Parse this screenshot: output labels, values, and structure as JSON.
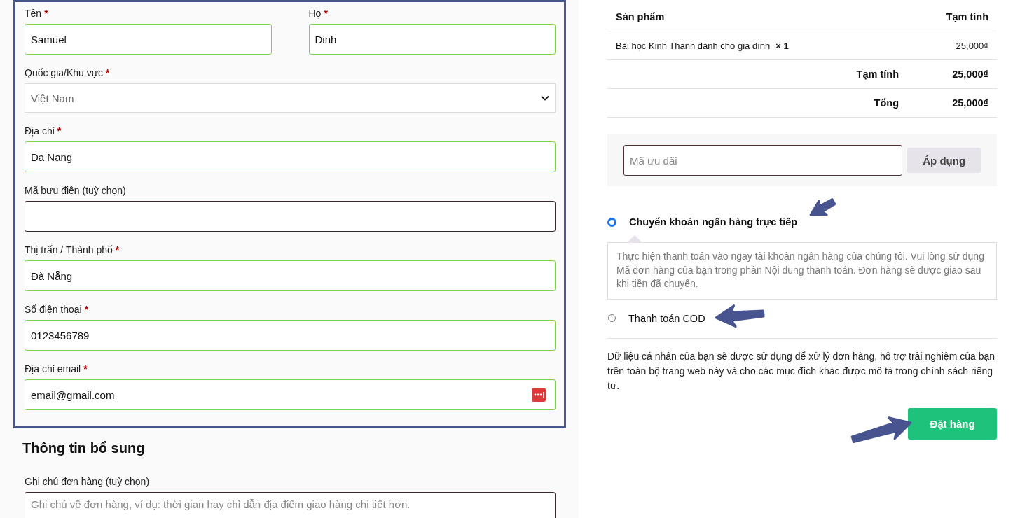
{
  "billing": {
    "rows": [
      [
        {
          "kind": "text",
          "label": "Tên",
          "required_mark": "*",
          "value": "Samuel",
          "validated": true
        },
        {
          "kind": "text",
          "label": "Họ",
          "required_mark": "*",
          "value": "Dinh",
          "validated": true
        }
      ],
      [
        {
          "kind": "select",
          "label": "Quốc gia/Khu vực",
          "required_mark": "*",
          "value": "Việt Nam",
          "validated": false
        }
      ],
      [
        {
          "kind": "text",
          "label": "Địa chỉ",
          "required_mark": "*",
          "value": "Da Nang",
          "validated": true
        }
      ],
      [
        {
          "kind": "text",
          "label": "Mã bưu điện (tuỳ chọn)",
          "validated": false
        }
      ],
      [
        {
          "kind": "text",
          "label": "Thị trấn / Thành phố",
          "required_mark": "*",
          "value": "Đà Nẵng",
          "validated": true
        }
      ],
      [
        {
          "kind": "text",
          "label": "Số điện thoại",
          "required_mark": "*",
          "value": "0123456789",
          "validated": true
        }
      ],
      [
        {
          "kind": "email",
          "label": "Địa chỉ email",
          "required_mark": "*",
          "value": "email@gmail.com",
          "validated": true
        }
      ]
    ]
  },
  "additional": {
    "title": "Thông tin bổ sung",
    "note_label": "Ghi chú đơn hàng (tuỳ chọn)",
    "note_placeholder": "Ghi chú về đơn hàng, ví dụ: thời gian hay chỉ dẫn địa điểm giao hàng chi tiết hơn."
  },
  "order": {
    "columns": [
      "Sản phẩm",
      "Tạm tính"
    ],
    "items": [
      {
        "name": "Bài học Kinh Thánh dành cho gia đình",
        "quantity": "× 1",
        "price": "25,000₫"
      }
    ],
    "totals": [
      {
        "label": "Tạm tính",
        "value": "25,000₫"
      },
      {
        "label": "Tổng",
        "value": "25,000₫"
      }
    ]
  },
  "coupon": {
    "placeholder": "Mã ưu đãi",
    "button": "Áp dụng"
  },
  "payment_methods": [
    {
      "label": "Chuyển khoản ngân hàng trực tiếp",
      "selected": true,
      "description": "Thực hiện thanh toán vào ngay tài khoản ngân hàng của chúng tôi. Vui lòng sử dụng Mã đơn hàng của bạn trong phần Nội dung thanh toán. Đơn hàng sẽ được giao sau khi tiền đã chuyển."
    },
    {
      "label": "Thanh toán COD",
      "selected": false
    }
  ],
  "privacy_text": "Dữ liệu cá nhân của bạn sẽ được sử dụng để xử lý đơn hàng, hỗ trợ trải nghiệm của bạn trên toàn bộ trang web này và cho các mục đích khác được mô tả trong chính sách riêng tư.",
  "place_order": "Đặt hàng"
}
